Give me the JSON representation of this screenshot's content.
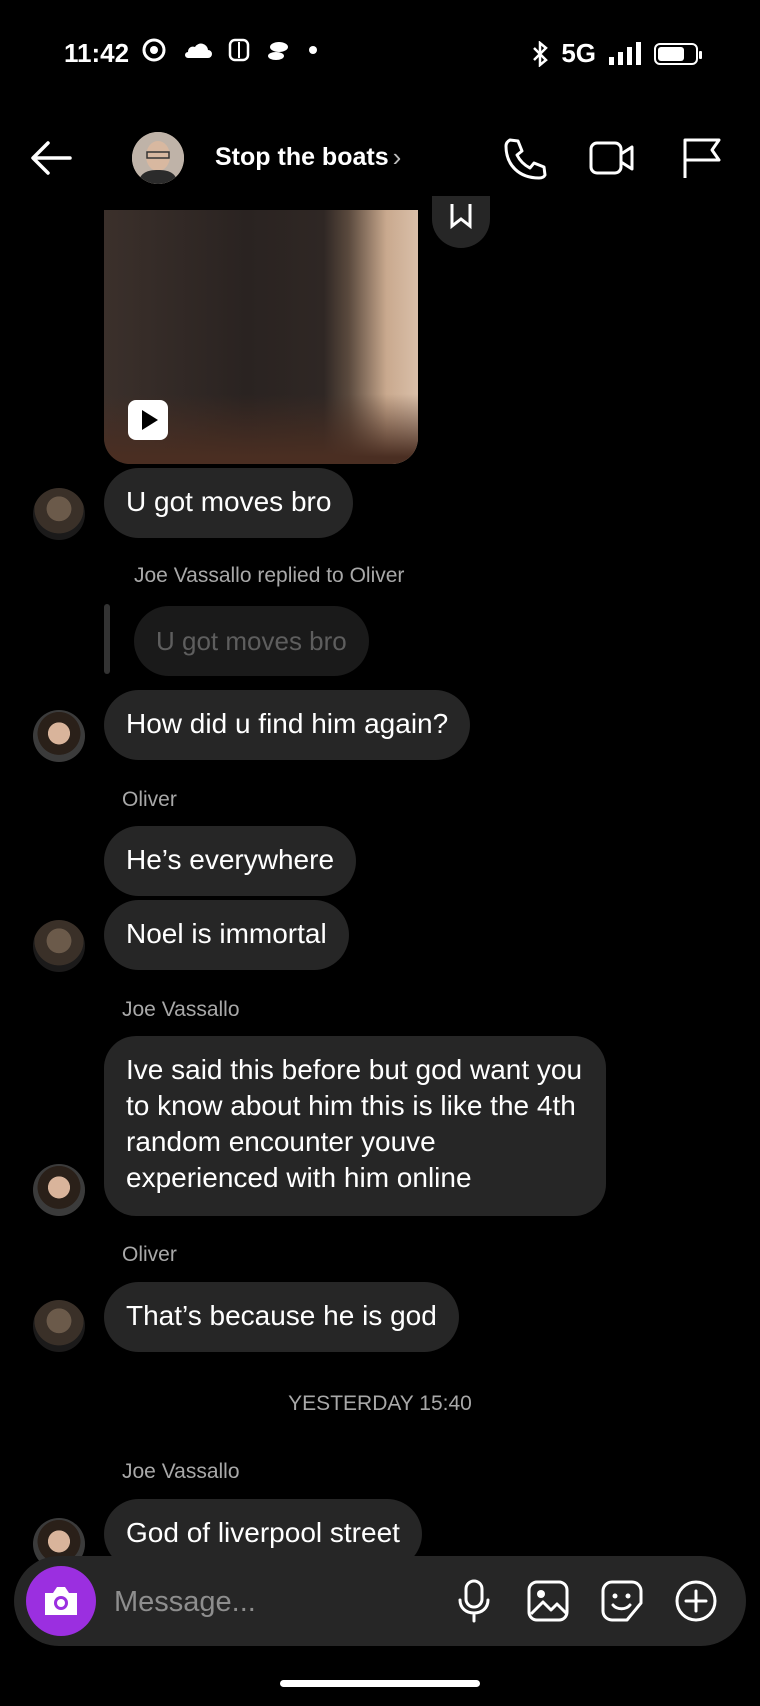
{
  "status_bar": {
    "time": "11:42",
    "network": "5G",
    "left_icons": [
      "chrome-icon",
      "cloud-icon",
      "sim-icon",
      "rocket-icon",
      "dot-icon"
    ],
    "right_icons": [
      "bluetooth-icon",
      "signal-icon",
      "battery-icon"
    ]
  },
  "header": {
    "title": "Stop the boats",
    "chevron": "›",
    "icons": [
      "back-arrow-icon",
      "phone-icon",
      "video-call-icon",
      "flag-icon"
    ]
  },
  "messages": {
    "m1": "U got moves bro",
    "reply_context": "Joe Vassallo replied to Oliver",
    "reply_quote": "U got moves bro",
    "m2": "How did u find him again?",
    "sender_oliver_1": "Oliver",
    "m3": "He’s everywhere",
    "m4": "Noel is immortal",
    "sender_joe_1": "Joe Vassallo",
    "m5": "Ive said this before but god want you to know about him this is like the 4th random encounter youve experienced with him online",
    "sender_oliver_2": "Oliver",
    "m6": "That’s because he is god",
    "timestamp": "YESTERDAY 15:40",
    "sender_joe_2": "Joe Vassallo",
    "m7": "God of liverpool street"
  },
  "composer": {
    "placeholder": "Message...",
    "icons": [
      "camera-icon",
      "microphone-icon",
      "gallery-icon",
      "sticker-icon",
      "add-icon"
    ]
  },
  "colors": {
    "background": "#000000",
    "bubble": "#262626",
    "camera_button": "#9b2fe0",
    "secondary_text": "#a8a8a8"
  }
}
